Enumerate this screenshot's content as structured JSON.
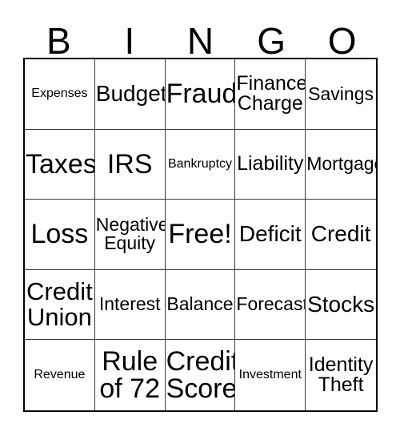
{
  "card": {
    "header": {
      "letters": [
        "B",
        "I",
        "N",
        "G",
        "O"
      ]
    },
    "grid": {
      "rows": 5,
      "columns": 5,
      "border_color": "#000000",
      "gridline_color": "#3a3a3a",
      "background_color": "#ffffff",
      "text_color": "#000000",
      "free_space_label": "Free!",
      "free_space_index": 12,
      "cells": [
        {
          "label": "Expenses",
          "size": "xs",
          "lines": 1
        },
        {
          "label": "Budget",
          "size": "lg",
          "lines": 1
        },
        {
          "label": "Fraud",
          "size": "xxl",
          "lines": 1
        },
        {
          "label": "Finance\nCharge",
          "size": "ml",
          "lines": 2
        },
        {
          "label": "Savings",
          "size": "md",
          "lines": 1
        },
        {
          "label": "Taxes",
          "size": "xxl",
          "lines": 1
        },
        {
          "label": "IRS",
          "size": "xxl",
          "lines": 1
        },
        {
          "label": "Bankruptcy",
          "size": "xs",
          "lines": 1
        },
        {
          "label": "Liability",
          "size": "ml",
          "lines": 1
        },
        {
          "label": "Mortgage",
          "size": "md",
          "lines": 1
        },
        {
          "label": "Loss",
          "size": "xxl",
          "lines": 1
        },
        {
          "label": "Negative\nEquity",
          "size": "md",
          "lines": 2
        },
        {
          "label": "Free!",
          "size": "xxl",
          "lines": 1
        },
        {
          "label": "Deficit",
          "size": "lg",
          "lines": 1
        },
        {
          "label": "Credit",
          "size": "lg",
          "lines": 1
        },
        {
          "label": "Credit\nUnion",
          "size": "xl",
          "lines": 2
        },
        {
          "label": "Interest",
          "size": "md",
          "lines": 1
        },
        {
          "label": "Balance",
          "size": "md",
          "lines": 1
        },
        {
          "label": "Forecast",
          "size": "md",
          "lines": 1
        },
        {
          "label": "Stocks",
          "size": "lg",
          "lines": 1
        },
        {
          "label": "Revenue",
          "size": "xs",
          "lines": 1
        },
        {
          "label": "Rule\nof 72",
          "size": "xxl",
          "lines": 2
        },
        {
          "label": "Credit\nScore",
          "size": "xxl",
          "lines": 2
        },
        {
          "label": "Investment",
          "size": "xs",
          "lines": 1
        },
        {
          "label": "Identity\nTheft",
          "size": "ml",
          "lines": 2
        }
      ]
    }
  }
}
